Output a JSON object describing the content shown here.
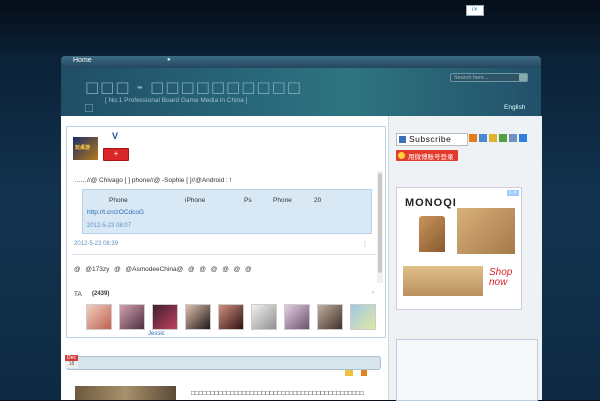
{
  "ad_choice": "i✕",
  "nav": {
    "home": "Home",
    "dot": "●"
  },
  "header": {
    "title": "□□□ - □□□□□□□□□□",
    "title_extra": "□",
    "subtitle": "[ No.1 Professional Board Game Media in China ]",
    "search_placeholder": "Search here...",
    "language": "English"
  },
  "weibo": {
    "logo_text": "玩桌游",
    "verified": "V",
    "follow_label": "+",
    "post1": "……//@ Chivago [ ] phone//@ -Sophie [ ]//@Android : !",
    "quote_words": [
      "Phone",
      "iPhone",
      "Ps",
      "Phone",
      "20"
    ],
    "quote_link": "http://t.cn/zOCdcoG",
    "quote_time": "2012-5-23 08:07",
    "post1_time": "2012-5-23 08:39",
    "post1_more": "⋮",
    "post2": "@ @173zy @ @AsmodeeChina@ @ @ @ @ @ @",
    "fans_label": "TA",
    "fans_count": "(2439)",
    "fans_arrow": "›",
    "fan_name": "Jessic"
  },
  "post": {
    "month": "Dec",
    "day": "18",
    "excerpt": "□□□□□□□□□□□□□□□□□□□□□□□□□□□□□□□□□□□□□□□□□□□□"
  },
  "sidebar": {
    "subscribe": "Subscribe",
    "weibo_login": "用微博账号登录",
    "ad_brand": "MONOQI",
    "ad_badge": "▷✕",
    "ad_shop": "Shop now"
  },
  "colors": {
    "accent_red": "#d8262b",
    "link_blue": "#2a6bb0",
    "header_teal": "#2a6a7c"
  }
}
